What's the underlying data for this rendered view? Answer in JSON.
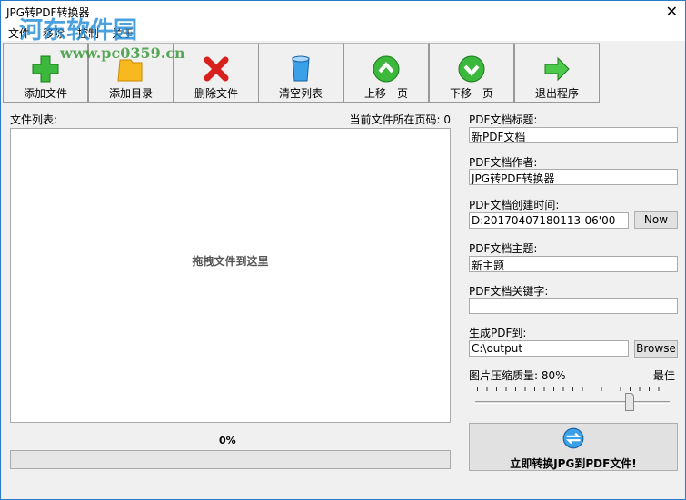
{
  "window": {
    "title": "JPG转PDF转换器",
    "close": "✕"
  },
  "menu": [
    "文件",
    "移除",
    "控制",
    "关于"
  ],
  "watermark": {
    "name": "河东软件园",
    "url": "www.pc0359.cn"
  },
  "toolbar": [
    {
      "label": "添加文件",
      "icon": "add-icon"
    },
    {
      "label": "添加目录",
      "icon": "folder-icon"
    },
    {
      "label": "删除文件",
      "icon": "delete-icon"
    },
    {
      "label": "清空列表",
      "icon": "trash-icon"
    },
    {
      "label": "上移一页",
      "icon": "up-icon"
    },
    {
      "label": "下移一页",
      "icon": "down-icon"
    },
    {
      "label": "退出程序",
      "icon": "exit-icon"
    }
  ],
  "file_list": {
    "label": "文件列表:",
    "current_page": "当前文件所在页码: 0",
    "drop_hint": "拖拽文件到这里",
    "progress_text": "0%",
    "progress": 0
  },
  "pdf": {
    "title_label": "PDF文档标题:",
    "title": "新PDF文档",
    "author_label": "PDF文档作者:",
    "author": "JPG转PDF转换器",
    "created_label": "PDF文档创建时间:",
    "created": "D:20170407180113-06'00",
    "now_button": "Now",
    "subject_label": "PDF文档主题:",
    "subject": "新主题",
    "keywords_label": "PDF文档关键字:",
    "keywords": "",
    "output_label": "生成PDF到:",
    "output": "C:\\output",
    "browse_button": "Browse",
    "quality_label": "图片压缩质量: 80%",
    "quality_best": "最佳",
    "quality": 80,
    "convert_button": "立即转换JPG到PDF文件!"
  }
}
